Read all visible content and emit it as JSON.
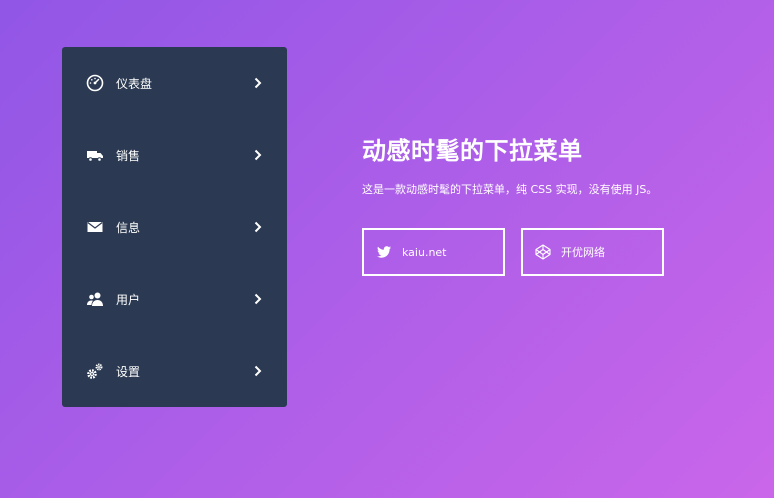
{
  "menu": {
    "items": [
      {
        "label": "仪表盘",
        "icon": "dashboard-icon"
      },
      {
        "label": "销售",
        "icon": "truck-icon"
      },
      {
        "label": "信息",
        "icon": "envelope-icon"
      },
      {
        "label": "用户",
        "icon": "users-icon"
      },
      {
        "label": "设置",
        "icon": "gears-icon"
      }
    ]
  },
  "content": {
    "title": "动感时髦的下拉菜单",
    "description": "这是一款动感时髦的下拉菜单，纯 CSS 实现，没有使用 JS。"
  },
  "buttons": [
    {
      "label": "kaiu.net",
      "icon": "twitter-icon"
    },
    {
      "label": "开优网络",
      "icon": "codepen-icon"
    }
  ],
  "colors": {
    "menu_bg": "#2b3a52",
    "gradient_start": "#9156e6",
    "gradient_end": "#ca66ea"
  }
}
